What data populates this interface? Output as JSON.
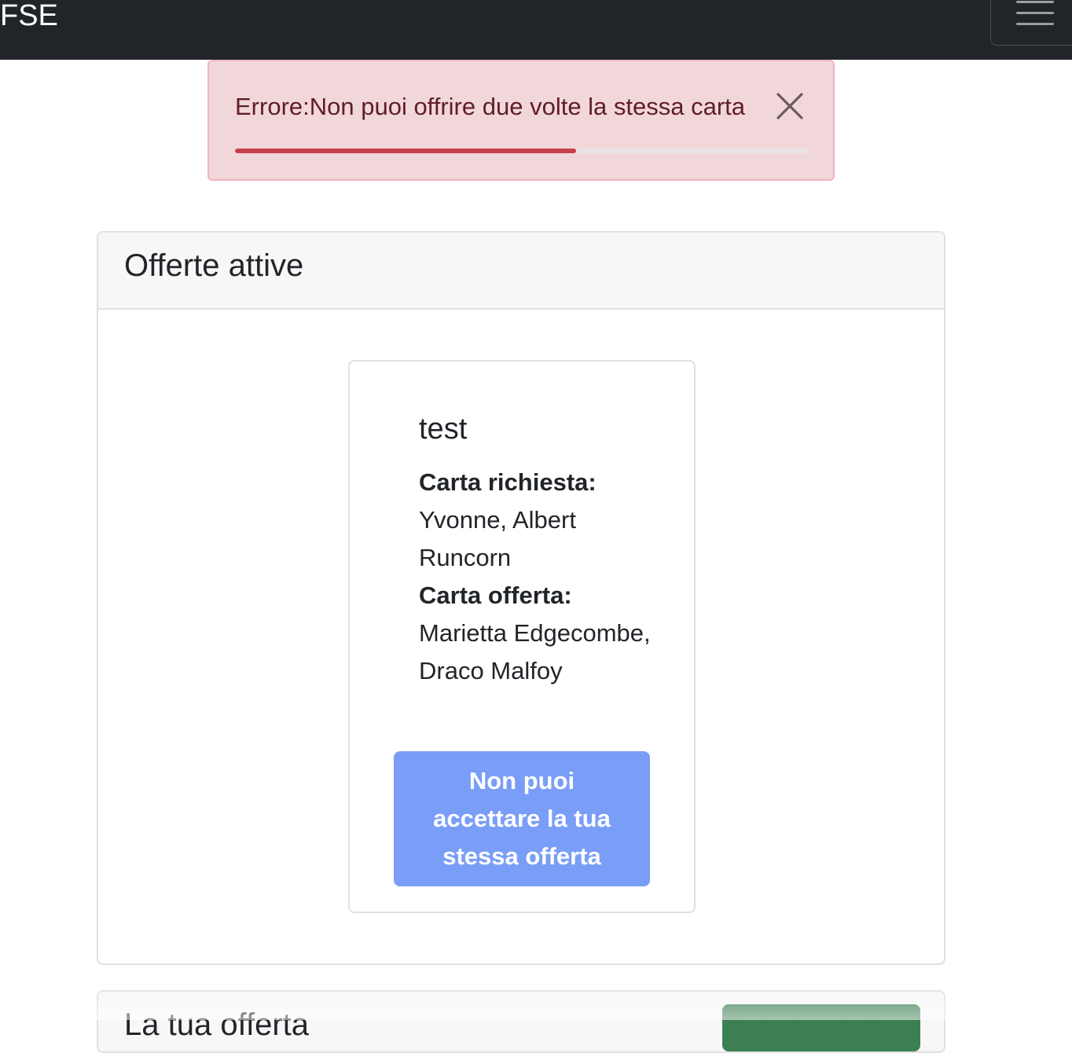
{
  "navbar": {
    "brand": "FSE",
    "menu_toggle_icon": "hamburger-menu-icon"
  },
  "alert": {
    "message": "Errore:Non puoi offrire due volte la stessa carta",
    "close_icon": "close-icon",
    "progress_fraction": 0.595,
    "colors": {
      "background": "#f2d7da",
      "text": "#5f1e24",
      "progress": "#c8404a"
    }
  },
  "active_offers": {
    "title": "Offerte attive",
    "offers": [
      {
        "title": "test",
        "requested_label": "Carta richiesta:",
        "requested_value": "Yvonne, Albert Runcorn",
        "offered_label": "Carta offerta:",
        "offered_value": "Marietta Edgecombe, Draco Malfoy",
        "action_label": "Non puoi accettare la tua stessa offerta"
      }
    ]
  },
  "my_offer": {
    "title": "La tua offerta"
  }
}
